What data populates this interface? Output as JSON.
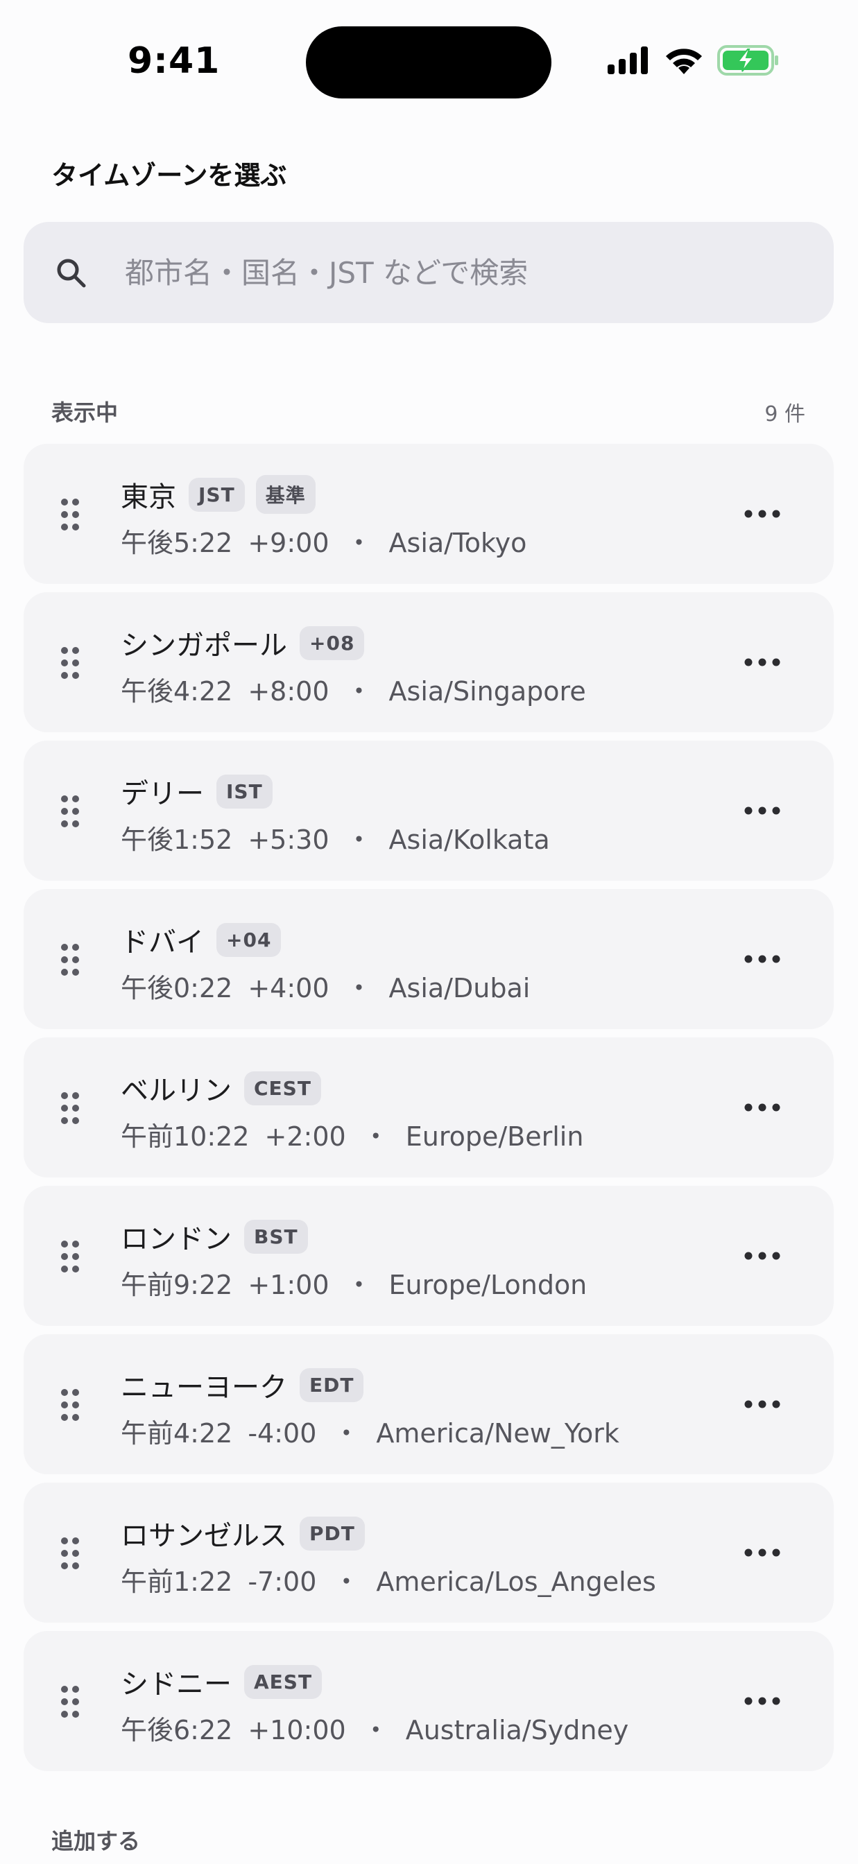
{
  "status_bar": {
    "time": "9:41",
    "icons": [
      "cellular-signal-icon",
      "wifi-icon",
      "battery-charging-icon"
    ],
    "battery_color": "#34c759"
  },
  "header": {
    "title": "タイムゾーンを選ぶ"
  },
  "search": {
    "placeholder": "都市名・国名・JST などで検索",
    "value": "",
    "icon": "search-icon"
  },
  "sections": {
    "showing": {
      "label": "表示中",
      "count": "9 件"
    },
    "add": {
      "label": "追加する"
    }
  },
  "timezones": [
    {
      "name": "東京",
      "badges": [
        "JST",
        "基準"
      ],
      "time": "午後5:22",
      "offset": "+9:00",
      "zone": "Asia/Tokyo"
    },
    {
      "name": "シンガポール",
      "badges": [
        "+08"
      ],
      "time": "午後4:22",
      "offset": "+8:00",
      "zone": "Asia/Singapore"
    },
    {
      "name": "デリー",
      "badges": [
        "IST"
      ],
      "time": "午後1:52",
      "offset": "+5:30",
      "zone": "Asia/Kolkata"
    },
    {
      "name": "ドバイ",
      "badges": [
        "+04"
      ],
      "time": "午後0:22",
      "offset": "+4:00",
      "zone": "Asia/Dubai"
    },
    {
      "name": "ベルリン",
      "badges": [
        "CEST"
      ],
      "time": "午前10:22",
      "offset": "+2:00",
      "zone": "Europe/Berlin"
    },
    {
      "name": "ロンドン",
      "badges": [
        "BST"
      ],
      "time": "午前9:22",
      "offset": "+1:00",
      "zone": "Europe/London"
    },
    {
      "name": "ニューヨーク",
      "badges": [
        "EDT"
      ],
      "time": "午前4:22",
      "offset": "-4:00",
      "zone": "America/New_York"
    },
    {
      "name": "ロサンゼルス",
      "badges": [
        "PDT"
      ],
      "time": "午前1:22",
      "offset": "-7:00",
      "zone": "America/Los_Angeles"
    },
    {
      "name": "シドニー",
      "badges": [
        "AEST"
      ],
      "time": "午後6:22",
      "offset": "+10:00",
      "zone": "Australia/Sydney"
    }
  ],
  "separator": "・"
}
